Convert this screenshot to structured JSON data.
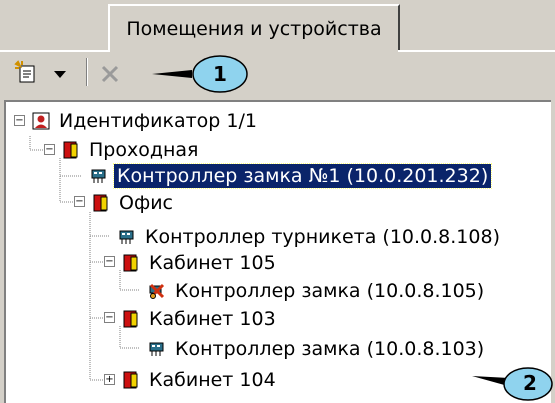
{
  "tab": {
    "label": "Помещения и устройства"
  },
  "toolbar": {
    "add_icon": "add-item-icon",
    "dropdown_icon": "chevron-down-icon",
    "delete_icon": "close-icon"
  },
  "callouts": {
    "one": "1",
    "two": "2"
  },
  "tree": {
    "root": "Идентификатор 1/1",
    "passage": "Проходная",
    "lock_controller_1": "Контроллер замка №1 (10.0.201.232)",
    "office": "Офис",
    "turnstile_controller": "Контроллер турникета (10.0.8.108)",
    "cabinet_105": "Кабинет 105",
    "lock_controller_105": "Контроллер замка (10.0.8.105)",
    "cabinet_103": "Кабинет 103",
    "lock_controller_103": "Контроллер замка (10.0.8.103)",
    "cabinet_104": "Кабинет 104"
  },
  "colors": {
    "selection": "#0a246a",
    "callout_fill": "#8fd3ee",
    "door_red": "#cc1010",
    "door_yellow": "#f2d200"
  }
}
